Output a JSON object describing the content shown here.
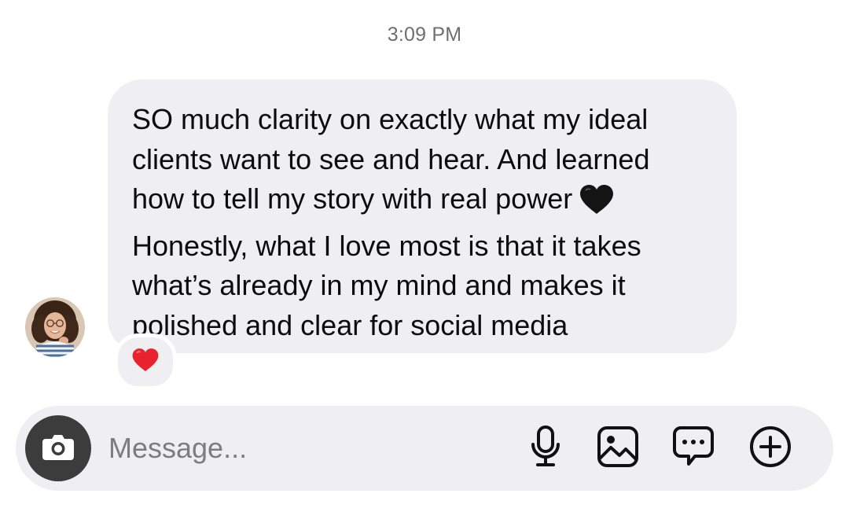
{
  "chat": {
    "timestamp": "3:09 PM",
    "message": {
      "lines": [
        "SO much clarity on exactly what my ideal",
        "clients want to see and hear. And learned",
        "how to tell my story with real power",
        "Honestly, what I love most is that it takes",
        "what’s already in my mind and makes it",
        "polished and clear for social media"
      ],
      "inline_emoji": "black-heart",
      "reaction": "red-heart"
    },
    "sender": {
      "avatar": "profile-photo"
    }
  },
  "composer": {
    "placeholder": "Message...",
    "camera_icon": "camera-icon",
    "tools": [
      "microphone-icon",
      "gallery-icon",
      "sticker-chat-icon",
      "plus-circle-icon"
    ]
  },
  "colors": {
    "bubble": "#efeef0",
    "text": "#0c0c0c",
    "timestamp": "#6f6f6f",
    "camera_button": "#3c3c3c",
    "reaction_heart": "#e8232f"
  }
}
